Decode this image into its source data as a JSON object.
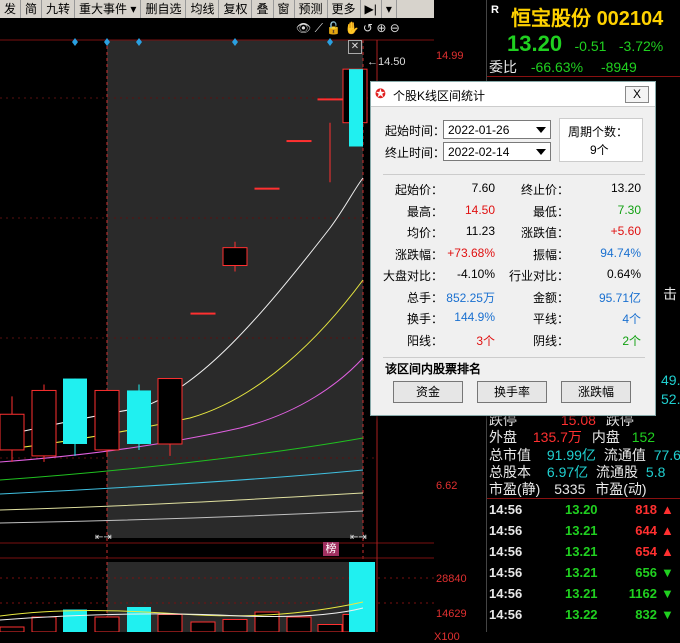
{
  "toolbar": {
    "items": [
      "发",
      "简",
      "九转",
      "重大事件",
      "删自选",
      "均线",
      "复权",
      "叠",
      "窗",
      "预测",
      "更多"
    ]
  },
  "chart": {
    "price_labels": {
      "top": "14.99",
      "high": "14.50",
      "low": "6.62"
    },
    "volume_labels": {
      "top": "28840",
      "mid": "14629",
      "unit": "X100"
    },
    "badge": "榜"
  },
  "chart_data": {
    "type": "candlestick",
    "note": "",
    "candles": [
      {
        "open": 8.7,
        "close": 8.1,
        "high": 9.0,
        "low": 7.9,
        "color": "red"
      },
      {
        "open": 8.0,
        "close": 9.1,
        "high": 9.2,
        "low": 7.9,
        "color": "red"
      },
      {
        "open": 9.3,
        "close": 8.2,
        "high": 9.3,
        "low": 8.0,
        "color": "cyan"
      },
      {
        "open": 8.1,
        "close": 9.1,
        "high": 9.1,
        "low": 8.0,
        "color": "red"
      },
      {
        "open": 9.1,
        "close": 8.2,
        "high": 9.2,
        "low": 8.1,
        "color": "cyan"
      },
      {
        "open": 8.2,
        "close": 9.3,
        "high": 9.3,
        "low": 8.0,
        "color": "red"
      },
      {
        "open": 10.4,
        "close": 10.4,
        "high": 10.4,
        "low": 10.4,
        "color": "red"
      },
      {
        "open": 11.2,
        "close": 11.5,
        "high": 11.6,
        "low": 11.1,
        "color": "red"
      },
      {
        "open": 12.5,
        "close": 12.5,
        "high": 12.5,
        "low": 12.5,
        "color": "red"
      },
      {
        "open": 13.3,
        "close": 13.3,
        "high": 13.3,
        "low": 13.3,
        "color": "red"
      },
      {
        "open": 14.0,
        "close": 14.0,
        "high": 14.0,
        "low": 14.0,
        "color": "red"
      },
      {
        "open": 14.5,
        "close": 13.6,
        "high": 14.5,
        "low": 13.2,
        "color": "red"
      },
      {
        "open": 14.5,
        "close": 13.2,
        "high": 14.5,
        "low": 13.2,
        "color": "cyan"
      }
    ],
    "volumes": [
      2,
      6,
      9,
      6,
      10,
      7,
      4,
      5,
      8,
      6,
      3,
      7,
      28
    ]
  },
  "stock": {
    "tag": "R",
    "name": "恒宝股份",
    "code": "002104",
    "price": "13.20",
    "change": "-0.51",
    "pct": "-3.72%",
    "weibi_label": "委比",
    "weibi": "-66.63%",
    "weicha": "-8949"
  },
  "quote": {
    "jiting_label": "跌停",
    "jiting_val": "15.08",
    "partial_side": "跌停",
    "waipan_label": "外盘",
    "waipan": "135.7万",
    "neipan_label": "内盘",
    "neipan": "152",
    "zsz_label": "总市值",
    "zsz": "91.99亿",
    "ltz_label": "流通值",
    "ltz": "77.6",
    "zgb_label": "总股本",
    "zgb": "6.97亿",
    "ltg_label": "流通股",
    "ltg": "5.8",
    "syl_label": "市盈(静)",
    "syl": "5335",
    "syld_label": "市盈(动)",
    "side_frag1": "击",
    "side_frag2": "49.",
    "side_frag3": "52."
  },
  "ticks": [
    {
      "time": "14:56",
      "price": "13.20",
      "vol": "818",
      "dir": "up"
    },
    {
      "time": "14:56",
      "price": "13.21",
      "vol": "644",
      "dir": "up"
    },
    {
      "time": "14:56",
      "price": "13.21",
      "vol": "654",
      "dir": "up"
    },
    {
      "time": "14:56",
      "price": "13.21",
      "vol": "656",
      "dir": "down"
    },
    {
      "time": "14:56",
      "price": "13.21",
      "vol": "1162",
      "dir": "down"
    },
    {
      "time": "14:56",
      "price": "13.22",
      "vol": "832",
      "dir": "down"
    }
  ],
  "dialog": {
    "title": "个股K线区间统计",
    "close": "X",
    "start_label": "起始时间：",
    "start_value": "2022-01-26",
    "end_label": "终止时间：",
    "end_value": "2022-02-14",
    "period_label": "周期个数：",
    "period_value": "9个",
    "stats": [
      {
        "l1": "起始价：",
        "v1": "7.60",
        "c1": "black",
        "l2": "终止价：",
        "v2": "13.20",
        "c2": "black"
      },
      {
        "l1": "最高：",
        "v1": "14.50",
        "c1": "red",
        "l2": "最低：",
        "v2": "7.30",
        "c2": "green"
      },
      {
        "l1": "均价：",
        "v1": "11.23",
        "c1": "black",
        "l2": "涨跌值：",
        "v2": "+5.60",
        "c2": "red"
      },
      {
        "l1": "涨跌幅：",
        "v1": "+73.68%",
        "c1": "red",
        "l2": "振幅：",
        "v2": "94.74%",
        "c2": "blue"
      },
      {
        "l1": "大盘对比：",
        "v1": "-4.10%",
        "c1": "black",
        "l2": "行业对比：",
        "v2": "0.64%",
        "c2": "black"
      },
      {
        "l1": "总手：",
        "v1": "852.25万",
        "c1": "blue",
        "l2": "金额：",
        "v2": "95.71亿",
        "c2": "blue"
      },
      {
        "l1": "换手：",
        "v1": "144.9%",
        "c1": "blue",
        "l2": "平线：",
        "v2": "4个",
        "c2": "blue"
      },
      {
        "l1": "阳线：",
        "v1": "3个",
        "c1": "red",
        "l2": "阴线：",
        "v2": "2个",
        "c2": "green"
      }
    ],
    "rank_title": "该区间内股票排名",
    "buttons": [
      "资金",
      "换手率",
      "涨跌幅"
    ]
  },
  "colors": {
    "up": "#ff3030",
    "down": "#20f0f0",
    "ma1": "#ffffff",
    "ma2": "#e8e840",
    "ma3": "#e060e0",
    "ma4": "#20c020"
  }
}
